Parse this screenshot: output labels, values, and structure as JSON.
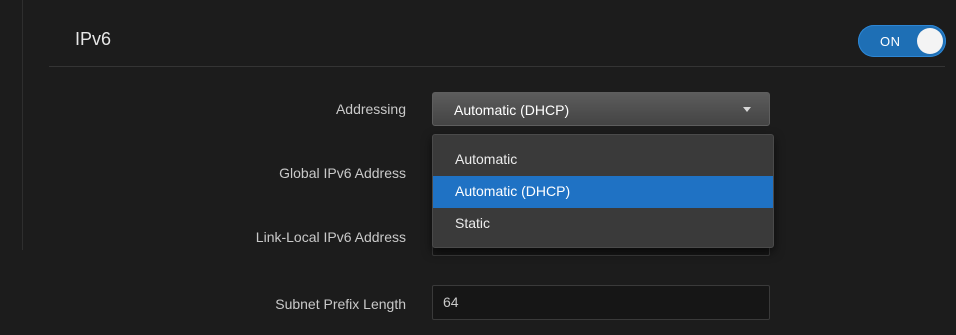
{
  "section": {
    "title": "IPv6",
    "toggle_label": "ON"
  },
  "fields": {
    "addressing_label": "Addressing",
    "addressing_value": "Automatic (DHCP)",
    "global_label": "Global IPv6 Address",
    "global_value": "",
    "link_local_label": "Link-Local IPv6 Address",
    "link_local_value": "",
    "prefix_label": "Subnet Prefix Length",
    "prefix_value": "64"
  },
  "dropdown": {
    "options": [
      "Automatic",
      "Automatic (DHCP)",
      "Static"
    ],
    "selected_index": 1
  },
  "colors": {
    "accent": "#1f72c4",
    "background": "#1c1c1c"
  }
}
